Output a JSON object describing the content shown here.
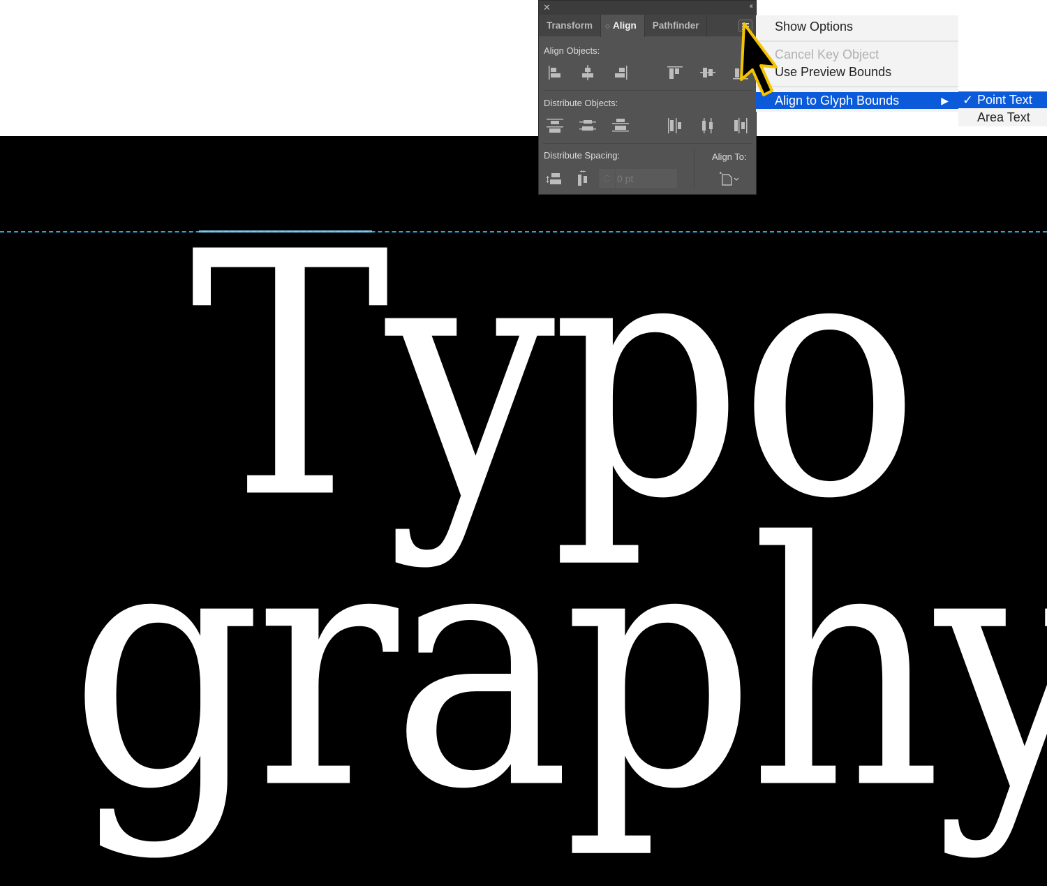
{
  "canvas": {
    "line1": "Typo",
    "line2": "graphy",
    "background": "#000000",
    "text_color": "#ffffff",
    "guide_color": "#2aa6dc"
  },
  "panel": {
    "tabs": [
      {
        "label": "Transform",
        "active": false
      },
      {
        "label": "Align",
        "active": true
      },
      {
        "label": "Pathfinder",
        "active": false
      }
    ],
    "align_objects_label": "Align Objects:",
    "distribute_objects_label": "Distribute Objects:",
    "distribute_spacing_label": "Distribute Spacing:",
    "align_to_label": "Align To:",
    "spacing_value": "0 pt",
    "align_objects_icons": [
      "horizontal-align-left-icon",
      "horizontal-align-center-icon",
      "horizontal-align-right-icon",
      "vertical-align-top-icon",
      "vertical-align-center-icon",
      "vertical-align-bottom-icon"
    ],
    "distribute_objects_icons": [
      "vertical-distribute-top-icon",
      "vertical-distribute-center-icon",
      "vertical-distribute-bottom-icon",
      "horizontal-distribute-left-icon",
      "horizontal-distribute-center-icon",
      "horizontal-distribute-right-icon"
    ],
    "distribute_spacing_icons": [
      "vertical-distribute-space-icon",
      "horizontal-distribute-space-icon"
    ],
    "align_to_icon": "align-to-artboard-icon"
  },
  "menu": {
    "items": [
      {
        "label": "Show Options",
        "disabled": false
      },
      {
        "label": "Cancel Key Object",
        "disabled": true
      },
      {
        "label": "Use Preview Bounds",
        "disabled": false
      },
      {
        "label": "Align to Glyph Bounds",
        "disabled": false,
        "highlighted": true,
        "submenu_arrow": "▶"
      }
    ],
    "submenu": [
      {
        "label": "Point Text",
        "checked": true,
        "check": "✓"
      },
      {
        "label": "Area Text",
        "checked": false
      }
    ],
    "highlight_color": "#0a5ad9"
  },
  "icons": {
    "close": "✕",
    "collapse": "‹‹",
    "tab_arrows": "⬍",
    "stepper": "▲▼"
  }
}
